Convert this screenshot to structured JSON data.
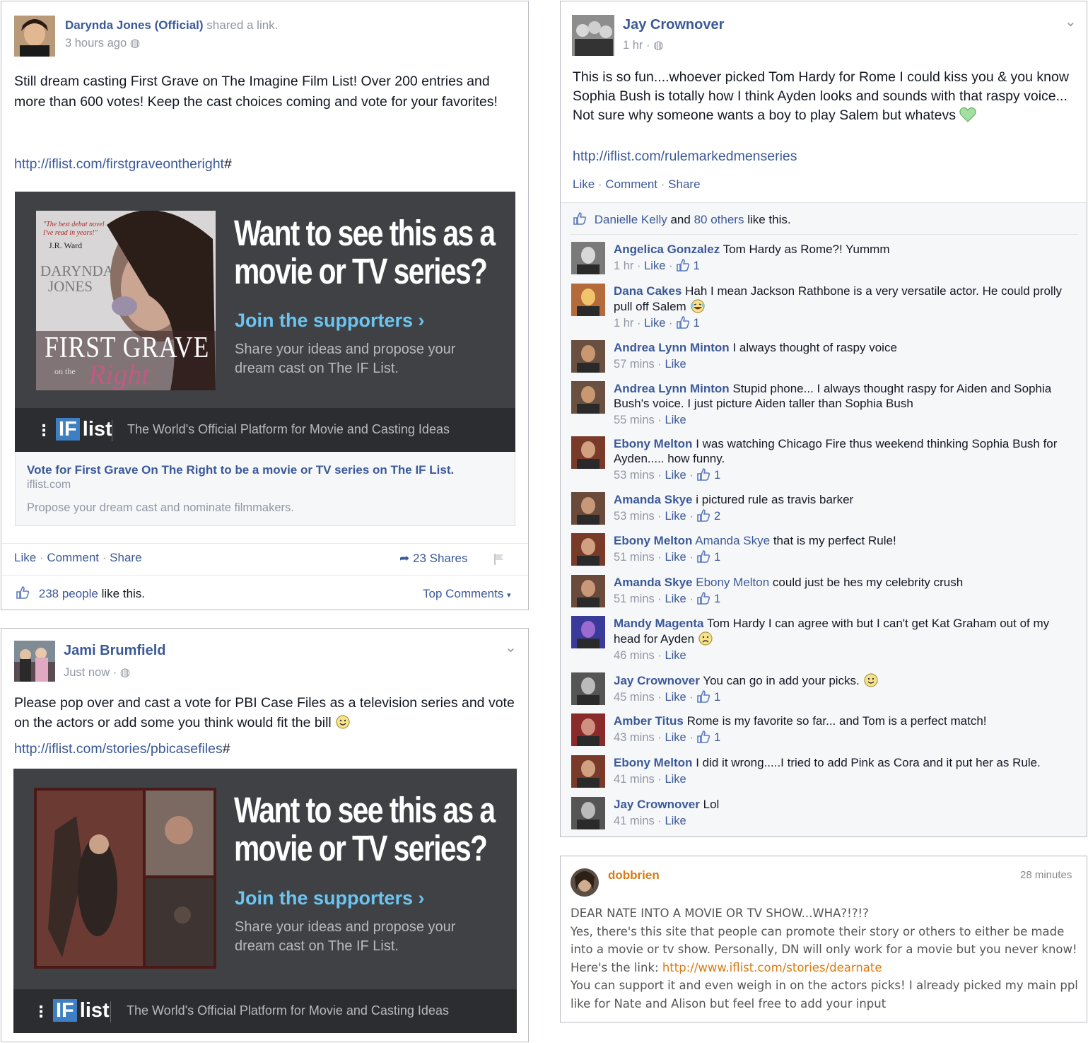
{
  "post1": {
    "author": "Darynda Jones (Official)",
    "action": "shared a link.",
    "time": "3 hours ago",
    "text": "Still dream casting First Grave on The Imagine Film List! Over 200 entries and more than 600 votes! Keep the cast choices coming and vote for your favorites!",
    "url": "http://iflist.com/firstgraveontheright",
    "url_hash": "#",
    "book": {
      "quote1": "\"The best debut novel",
      "quote2": "I've read in years!\"",
      "quote_author": "J.R. Ward",
      "author1": "DARYNDA",
      "author2": "JONES",
      "title1": "FIRST GRAVE",
      "title2": "on the",
      "title3": "Right"
    },
    "banner": {
      "headline1": "Want to see this as a",
      "headline2": "movie or TV series?",
      "join": "Join the supporters ›",
      "share1": "Share your ideas and propose your",
      "share2": "dream cast on The IF List.",
      "logo_if": "IF",
      "logo_list": "list",
      "tagline": "The World's Official Platform for Movie and Casting Ideas"
    },
    "link_title": "Vote for First Grave On The Right to be a movie or TV series on The IF List.",
    "link_domain": "iflist.com",
    "link_desc": "Propose your dream cast and nominate filmmakers.",
    "like": "Like",
    "comment": "Comment",
    "share": "Share",
    "shares_count": "23 Shares",
    "likes_people": "238 people",
    "likes_suffix": "like this.",
    "top_comments": "Top Comments"
  },
  "post2": {
    "author": "Jami Brumfield",
    "time": "Just now",
    "text": "Please pop over and cast a vote for PBI Case Files as a television series and vote on the actors or add some you think would fit the bill",
    "url": "http://iflist.com/stories/pbicasefiles",
    "url_hash": "#",
    "banner": {
      "headline1": "Want to see this as a",
      "headline2": "movie or TV series?",
      "join": "Join the supporters ›",
      "share1": "Share your ideas and propose your",
      "share2": "dream cast on The IF List.",
      "logo_if": "IF",
      "logo_list": "list",
      "tagline": "The World's Official Platform for Movie and Casting Ideas"
    }
  },
  "post3": {
    "author": "Jay Crownover",
    "time": "1 hr",
    "text1": "This is so fun....whoever picked Tom Hardy for Rome I could kiss you & you know Sophia Bush is totally how I think Ayden looks and sounds with that raspy voice...",
    "text2": "Not sure why someone wants a boy to play Salem but whatevs",
    "url": "http://iflist.com/rulemarkedmenseries",
    "like": "Like",
    "comment": "Comment",
    "share": "Share",
    "likes_name": "Danielle Kelly",
    "likes_and": "and",
    "likes_others": "80 others",
    "likes_suffix": "like this.",
    "comments": [
      {
        "name": "Angelica Gonzalez",
        "text": "Tom Hardy as Rome?! Yummm",
        "time": "1 hr",
        "like": "Like",
        "count": "1"
      },
      {
        "name": "Dana Cakes",
        "text": "Hah I mean Jackson Rathbone is a very versatile actor. He could prolly pull off Salem",
        "time": "1 hr",
        "like": "Like",
        "count": "1"
      },
      {
        "name": "Andrea Lynn Minton",
        "text": "I always thought of raspy voice",
        "time": "57 mins",
        "like": "Like",
        "count": ""
      },
      {
        "name": "Andrea Lynn Minton",
        "text": "Stupid phone... I always thought raspy for Aiden and Sophia Bush's voice. I just picture Aiden taller than Sophia Bush",
        "time": "55 mins",
        "like": "Like",
        "count": ""
      },
      {
        "name": "Ebony Melton",
        "text": "I was watching Chicago Fire thus weekend thinking Sophia Bush for Ayden..... how funny.",
        "time": "53 mins",
        "like": "Like",
        "count": "1"
      },
      {
        "name": "Amanda Skye",
        "text": "i pictured rule as travis barker",
        "time": "53 mins",
        "like": "Like",
        "count": "2"
      },
      {
        "name": "Ebony Melton",
        "tag": "Amanda Skye",
        "text": "that is my perfect Rule!",
        "time": "51 mins",
        "like": "Like",
        "count": "1"
      },
      {
        "name": "Amanda Skye",
        "tag": "Ebony Melton",
        "text": "could just be hes my celebrity crush",
        "time": "51 mins",
        "like": "Like",
        "count": "1"
      },
      {
        "name": "Mandy Magenta",
        "text": "Tom Hardy I can agree with but I can't get Kat Graham out of my head for Ayden",
        "time": "46 mins",
        "like": "Like",
        "count": ""
      },
      {
        "name": "Jay Crownover",
        "text": "You can go in add your picks.",
        "time": "45 mins",
        "like": "Like",
        "count": "1"
      },
      {
        "name": "Amber Titus",
        "text": "Rome is my favorite so far... and Tom is a perfect match!",
        "time": "43 mins",
        "like": "Like",
        "count": "1"
      },
      {
        "name": "Ebony Melton",
        "text": "I did it wrong.....I tried to add Pink as Cora and it put her as Rule.",
        "time": "41 mins",
        "like": "Like",
        "count": ""
      },
      {
        "name": "Jay Crownover",
        "text": "Lol",
        "time": "41 mins",
        "like": "Like",
        "count": ""
      }
    ]
  },
  "post4": {
    "author": "dobbrien",
    "time": "28 minutes",
    "title": "DEAR NATE INTO A MOVIE OR TV SHOW...WHA?!?!?",
    "text1": "Yes, there's this site that people can promote their story or others to either be made into a movie or tv show. Personally, DN will only work for a movie but you never know! Here's the link:",
    "url": "http://www.iflist.com/stories/dearnate",
    "text2": "You can support it and even weigh in on the actors picks! I already picked my main ppl like for Nate and Alison but feel free to add your input"
  },
  "colors": {
    "fb_blue": "#3b5998",
    "banner_bg": "#3f4144",
    "join_blue": "#6cc4f0",
    "dob_orange": "#d97b12"
  }
}
